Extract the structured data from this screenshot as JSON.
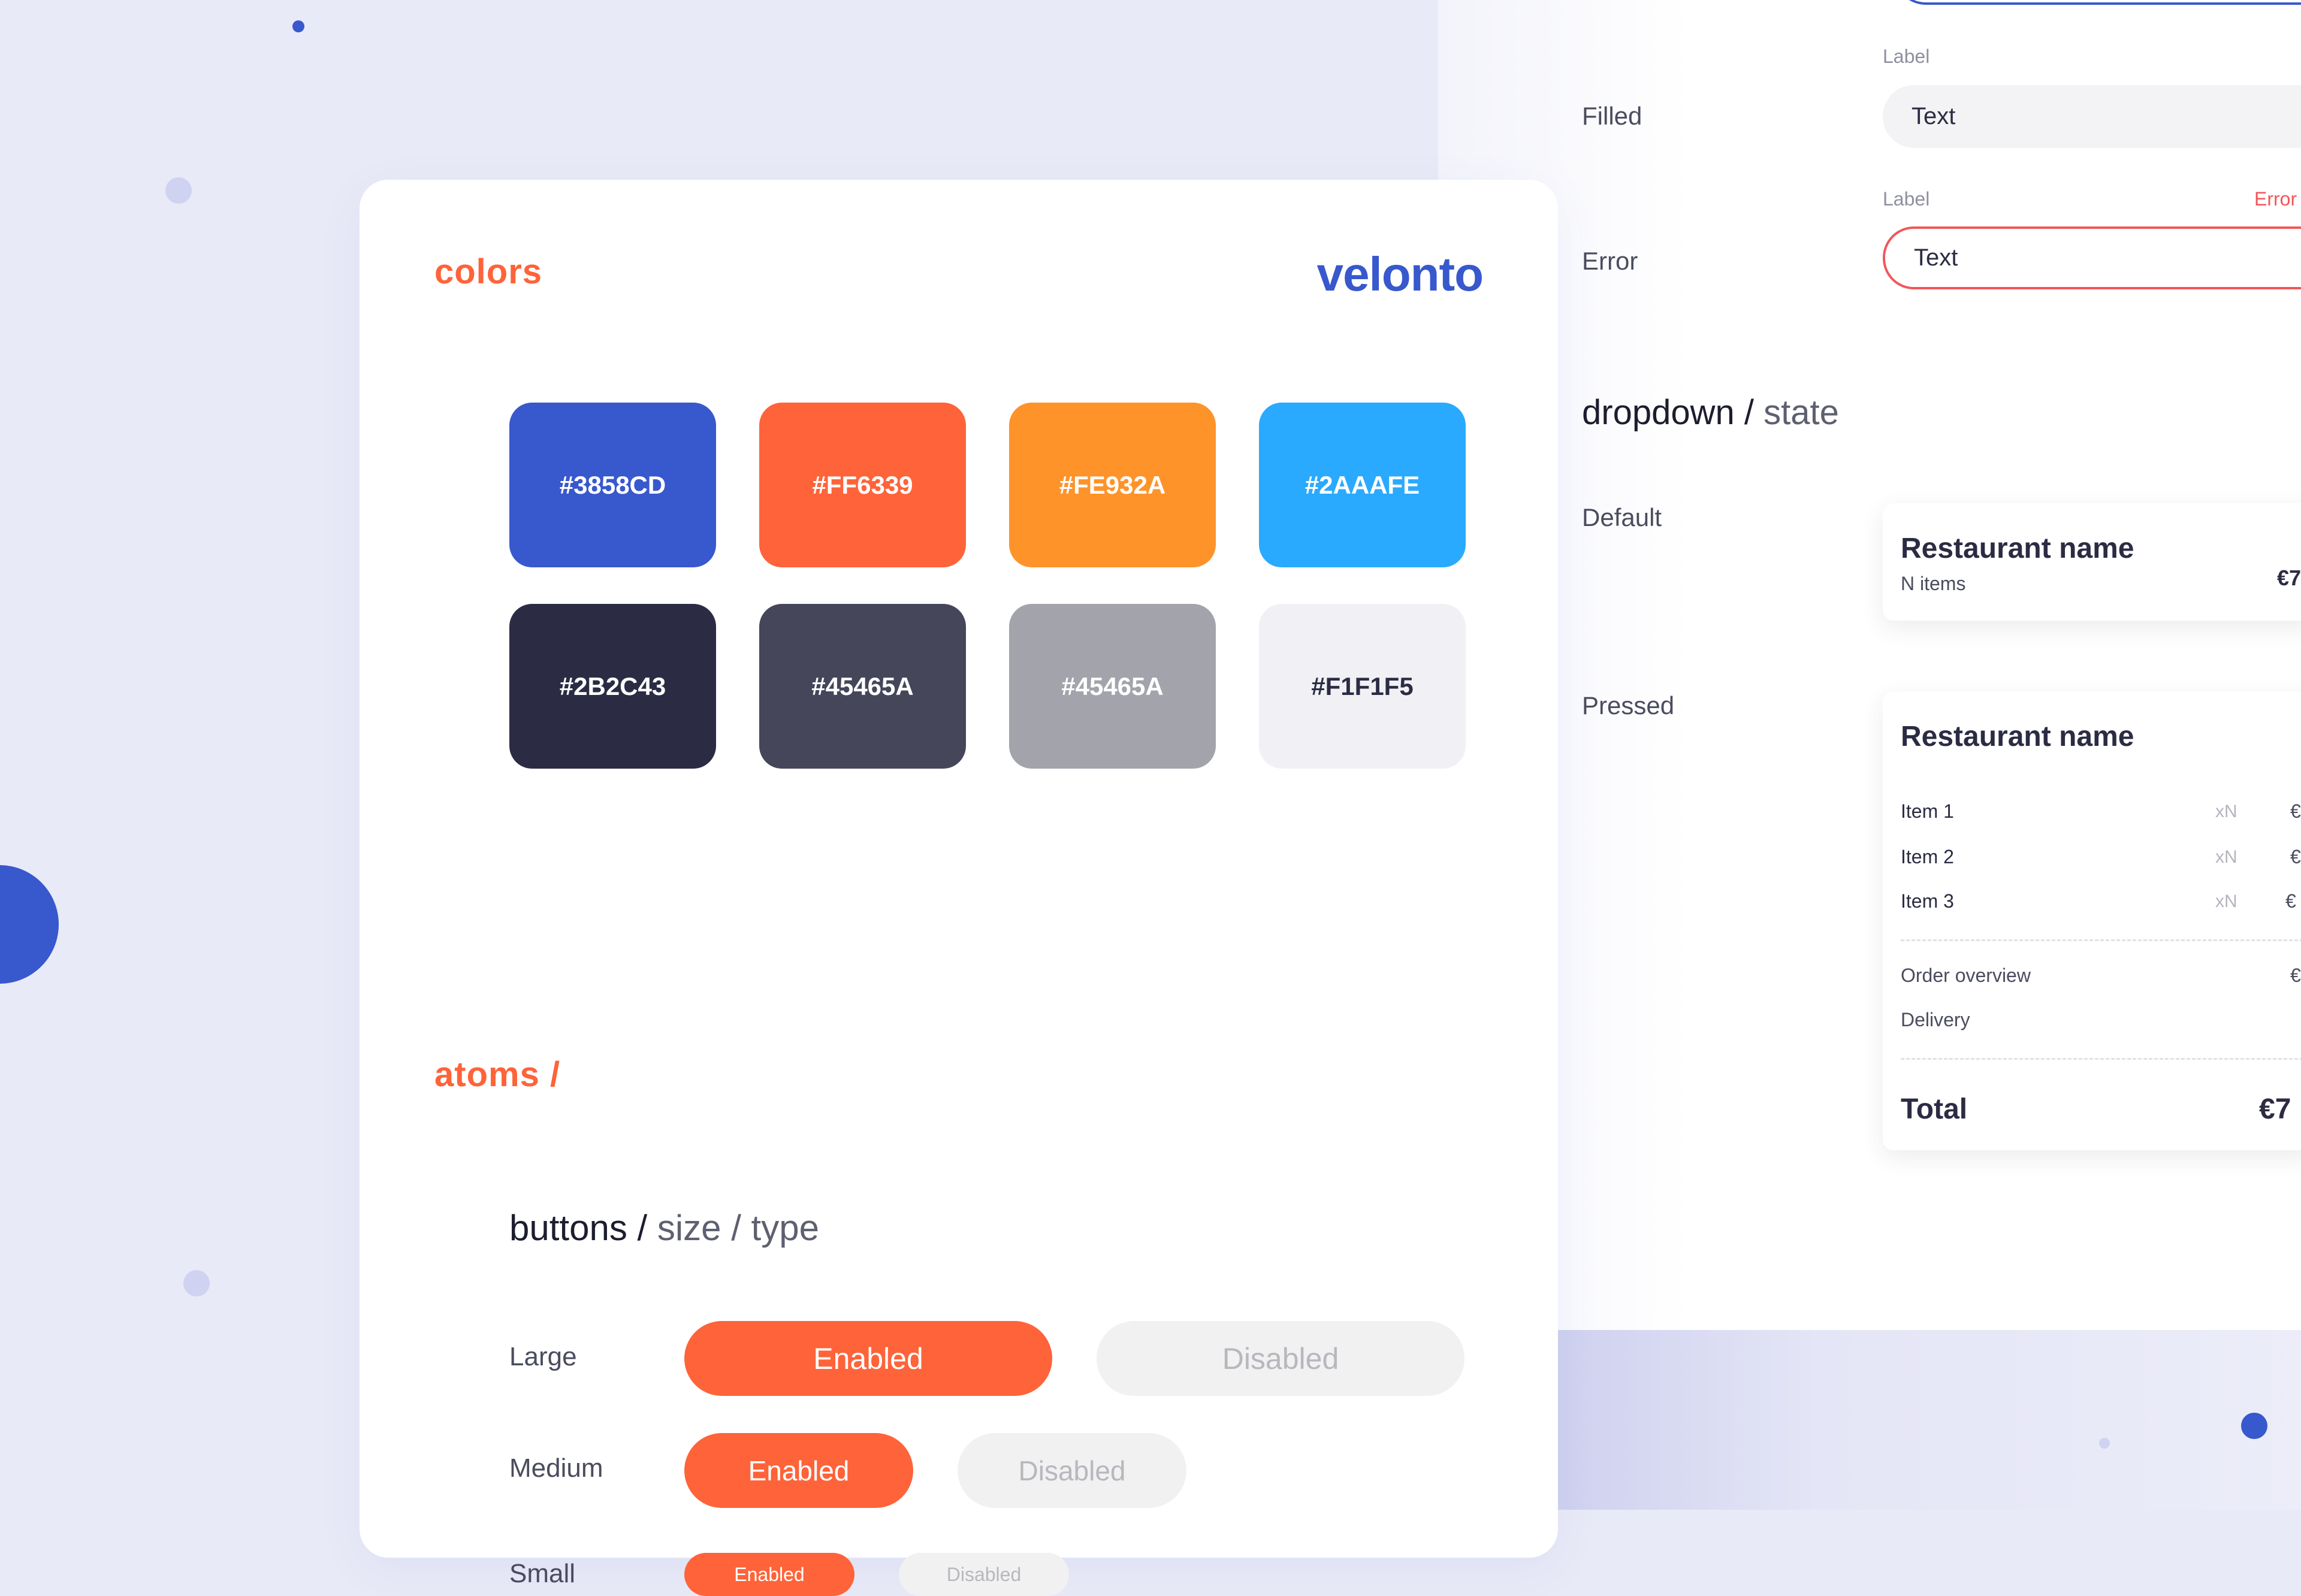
{
  "colors_section": {
    "title": "colors",
    "brand": "velonto",
    "swatches": [
      {
        "label": "#3858CD",
        "color": "#3858cd",
        "text_color": "#ffffff"
      },
      {
        "label": "#FF6339",
        "color": "#ff6339",
        "text_color": "#ffffff"
      },
      {
        "label": "#FE932A",
        "color": "#fe932a",
        "text_color": "#ffffff"
      },
      {
        "label": "#2AAAFE",
        "color": "#2aaafe",
        "text_color": "#ffffff"
      },
      {
        "label": "#2B2C43",
        "color": "#2b2c43",
        "text_color": "#ffffff"
      },
      {
        "label": "#45465A",
        "color": "#45465a",
        "text_color": "#ffffff"
      },
      {
        "label": "#45465A",
        "color": "#a3a3ac",
        "text_color": "#ffffff"
      },
      {
        "label": "#F1F1F5",
        "color": "#f1f1f5",
        "text_color": "#2b2c43"
      }
    ]
  },
  "atoms_section": {
    "title": "atoms /",
    "buttons_heading": {
      "strong": "buttons /",
      "muted": "size / type"
    },
    "rows": [
      {
        "size": "Large",
        "enabled": "Enabled",
        "disabled": "Disabled"
      },
      {
        "size": "Medium",
        "enabled": "Enabled",
        "disabled": "Disabled"
      },
      {
        "size": "Small",
        "enabled": "Enabled",
        "disabled": "Disabled"
      }
    ]
  },
  "inputs_panel": {
    "filled": {
      "state": "Filled",
      "label": "Label",
      "value": "Text"
    },
    "error": {
      "state": "Error",
      "label": "Label",
      "error_text": "Error",
      "value": "Text"
    }
  },
  "dropdown_panel": {
    "heading": {
      "strong": "dropdown /",
      "muted": "state"
    },
    "default": {
      "state": "Default",
      "restaurant": "Restaurant name",
      "items_count": "N items",
      "price_partial": "€7"
    },
    "pressed": {
      "state": "Pressed",
      "restaurant": "Restaurant name",
      "items": [
        {
          "name": "Item 1",
          "qty": "xN",
          "price_partial": "€"
        },
        {
          "name": "Item 2",
          "qty": "xN",
          "price_partial": "€"
        },
        {
          "name": "Item 3",
          "qty": "xN",
          "price_partial": "€"
        }
      ],
      "order_overview": {
        "label": "Order overview",
        "price_partial": "€"
      },
      "delivery": {
        "label": "Delivery"
      },
      "total": {
        "label": "Total",
        "price_partial": "€7"
      }
    }
  },
  "accent_colors": {
    "primary": "#3858cd",
    "orange": "#ff6339",
    "error": "#f2565a"
  }
}
